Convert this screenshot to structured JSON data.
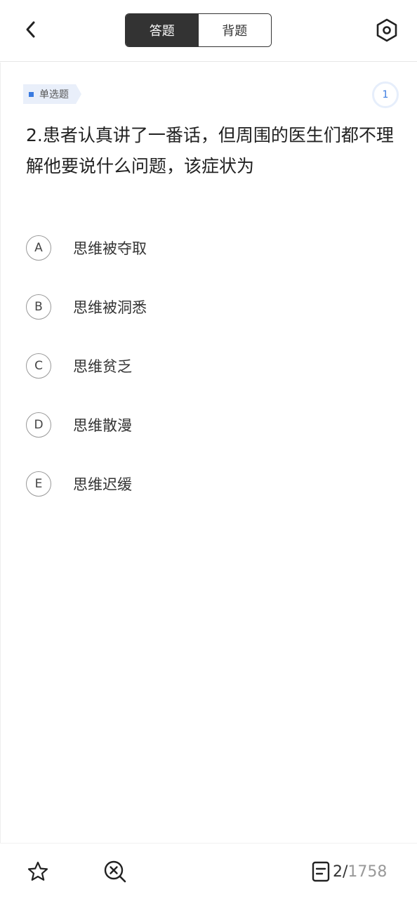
{
  "header": {
    "tabs": [
      {
        "label": "答题",
        "active": true
      },
      {
        "label": "背题",
        "active": false
      }
    ]
  },
  "question": {
    "type_label": "单选题",
    "badge": "1",
    "text": "2.患者认真讲了一番话，但周围的医生们都不理解他要说什么问题，该症状为",
    "options": [
      {
        "letter": "A",
        "text": "思维被夺取"
      },
      {
        "letter": "B",
        "text": "思维被洞悉"
      },
      {
        "letter": "C",
        "text": "思维贫乏"
      },
      {
        "letter": "D",
        "text": "思维散漫"
      },
      {
        "letter": "E",
        "text": "思维迟缓"
      }
    ]
  },
  "footer": {
    "current": "2",
    "separator": "/",
    "total": "1758"
  },
  "icons": {
    "back": "chevron-left-icon",
    "settings": "hexagon-settings-icon",
    "favorite": "star-icon",
    "clear": "search-close-icon",
    "sheet": "answer-sheet-icon"
  },
  "colors": {
    "accent": "#3a7be0",
    "segment_active": "#333333",
    "tag_bg": "#e9effa"
  }
}
